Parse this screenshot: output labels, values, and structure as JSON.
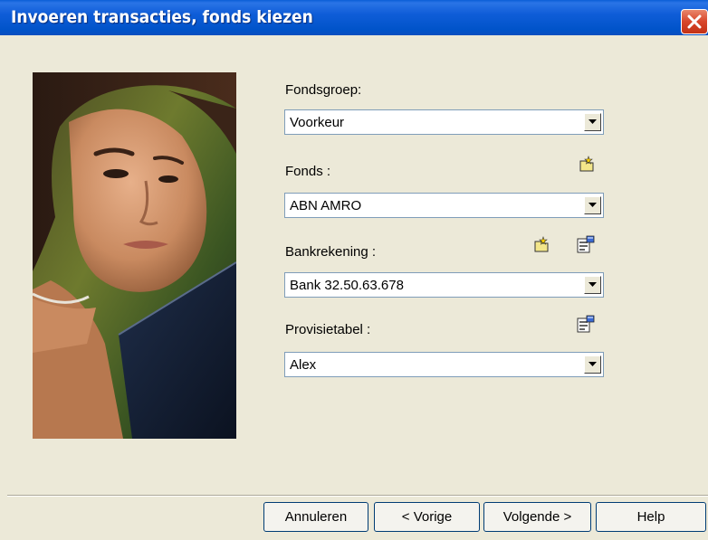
{
  "window": {
    "title": "Invoeren transacties, fonds kiezen"
  },
  "fields": {
    "fondsgroep": {
      "label": "Fondsgroep:",
      "value": "Voorkeur"
    },
    "fonds": {
      "label": "Fonds :",
      "value": "ABN AMRO"
    },
    "bankrekening": {
      "label": "Bankrekening :",
      "value": "Bank 32.50.63.678"
    },
    "provisietabel": {
      "label": "Provisietabel :",
      "value": "Alex"
    }
  },
  "buttons": {
    "cancel": "Annuleren",
    "back": "< Vorige",
    "next": "Volgende >",
    "help": "Help"
  },
  "icons": {
    "new": "new-item-icon",
    "properties": "properties-icon",
    "close": "close-icon",
    "dropdown": "chevron-down-icon"
  },
  "colors": {
    "titlebar": "#0053c9",
    "dialog_bg": "#ece9d8",
    "close_button": "#d8462a"
  }
}
